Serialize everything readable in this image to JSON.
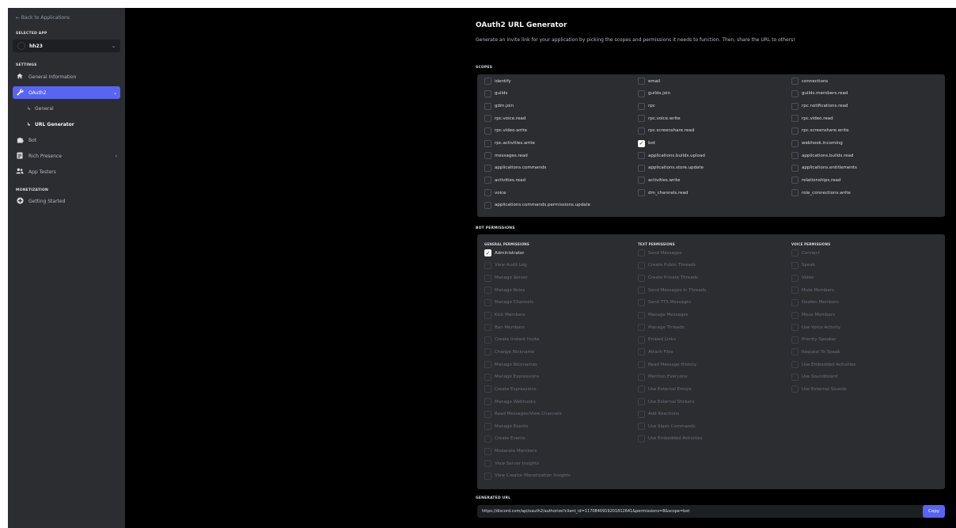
{
  "sidebar": {
    "back_link": "← Back to Applications",
    "selected_app_label": "SELECTED APP",
    "app_name": "hh23",
    "settings_label": "SETTINGS",
    "monetization_label": "MONETIZATION",
    "items": {
      "general_information": "General Information",
      "oauth2": "OAuth2",
      "general": "General",
      "url_generator": "URL Generator",
      "bot": "Bot",
      "rich_presence": "Rich Presence",
      "app_testers": "App Testers",
      "getting_started": "Getting Started"
    },
    "sub_prefix": "↳"
  },
  "page": {
    "title": "OAuth2 URL Generator",
    "description": "Generate an invite link for your application by picking the scopes and permissions it needs to function. Then, share the URL to others!",
    "scopes_label": "SCOPES",
    "bot_permissions_label": "BOT PERMISSIONS",
    "generated_url_label": "GENERATED URL"
  },
  "scopes": [
    [
      {
        "label": "identify",
        "checked": false
      },
      {
        "label": "guilds",
        "checked": false
      },
      {
        "label": "gdm.join",
        "checked": false
      },
      {
        "label": "rpc.voice.read",
        "checked": false
      },
      {
        "label": "rpc.video.write",
        "checked": false
      },
      {
        "label": "rpc.activities.write",
        "checked": false
      },
      {
        "label": "messages.read",
        "checked": false
      },
      {
        "label": "applications.commands",
        "checked": false
      },
      {
        "label": "activities.read",
        "checked": false
      },
      {
        "label": "voice",
        "checked": false
      },
      {
        "label": "applications.commands.permissions.update",
        "checked": false
      }
    ],
    [
      {
        "label": "email",
        "checked": false
      },
      {
        "label": "guilds.join",
        "checked": false
      },
      {
        "label": "rpc",
        "checked": false
      },
      {
        "label": "rpc.voice.write",
        "checked": false
      },
      {
        "label": "rpc.screenshare.read",
        "checked": false
      },
      {
        "label": "bot",
        "checked": true
      },
      {
        "label": "applications.builds.upload",
        "checked": false
      },
      {
        "label": "applications.store.update",
        "checked": false
      },
      {
        "label": "activities.write",
        "checked": false
      },
      {
        "label": "dm_channels.read",
        "checked": false
      }
    ],
    [
      {
        "label": "connections",
        "checked": false
      },
      {
        "label": "guilds.members.read",
        "checked": false
      },
      {
        "label": "rpc.notifications.read",
        "checked": false
      },
      {
        "label": "rpc.video.read",
        "checked": false
      },
      {
        "label": "rpc.screenshare.write",
        "checked": false
      },
      {
        "label": "webhook.incoming",
        "checked": false
      },
      {
        "label": "applications.builds.read",
        "checked": false
      },
      {
        "label": "applications.entitlements",
        "checked": false
      },
      {
        "label": "relationships.read",
        "checked": false
      },
      {
        "label": "role_connections.write",
        "checked": false
      }
    ]
  ],
  "permissions": [
    {
      "header": "GENERAL PERMISSIONS",
      "items": [
        {
          "label": "Administrator",
          "checked": true
        },
        {
          "label": "View Audit Log",
          "checked": false
        },
        {
          "label": "Manage Server",
          "checked": false
        },
        {
          "label": "Manage Roles",
          "checked": false
        },
        {
          "label": "Manage Channels",
          "checked": false
        },
        {
          "label": "Kick Members",
          "checked": false
        },
        {
          "label": "Ban Members",
          "checked": false
        },
        {
          "label": "Create Instant Invite",
          "checked": false
        },
        {
          "label": "Change Nickname",
          "checked": false
        },
        {
          "label": "Manage Nicknames",
          "checked": false
        },
        {
          "label": "Manage Expressions",
          "checked": false
        },
        {
          "label": "Create Expressions",
          "checked": false
        },
        {
          "label": "Manage Webhooks",
          "checked": false
        },
        {
          "label": "Read Messages/View Channels",
          "checked": false
        },
        {
          "label": "Manage Events",
          "checked": false
        },
        {
          "label": "Create Events",
          "checked": false
        },
        {
          "label": "Moderate Members",
          "checked": false
        },
        {
          "label": "View Server Insights",
          "checked": false
        },
        {
          "label": "View Creator Monetization Insights",
          "checked": false
        }
      ]
    },
    {
      "header": "TEXT PERMISSIONS",
      "items": [
        {
          "label": "Send Messages",
          "checked": false
        },
        {
          "label": "Create Public Threads",
          "checked": false
        },
        {
          "label": "Create Private Threads",
          "checked": false
        },
        {
          "label": "Send Messages in Threads",
          "checked": false
        },
        {
          "label": "Send TTS Messages",
          "checked": false
        },
        {
          "label": "Manage Messages",
          "checked": false
        },
        {
          "label": "Manage Threads",
          "checked": false
        },
        {
          "label": "Embed Links",
          "checked": false
        },
        {
          "label": "Attach Files",
          "checked": false
        },
        {
          "label": "Read Message History",
          "checked": false
        },
        {
          "label": "Mention Everyone",
          "checked": false
        },
        {
          "label": "Use External Emojis",
          "checked": false
        },
        {
          "label": "Use External Stickers",
          "checked": false
        },
        {
          "label": "Add Reactions",
          "checked": false
        },
        {
          "label": "Use Slash Commands",
          "checked": false
        },
        {
          "label": "Use Embedded Activities",
          "checked": false
        }
      ]
    },
    {
      "header": "VOICE PERMISSIONS",
      "items": [
        {
          "label": "Connect",
          "checked": false
        },
        {
          "label": "Speak",
          "checked": false
        },
        {
          "label": "Video",
          "checked": false
        },
        {
          "label": "Mute Members",
          "checked": false
        },
        {
          "label": "Deafen Members",
          "checked": false
        },
        {
          "label": "Move Members",
          "checked": false
        },
        {
          "label": "Use Voice Activity",
          "checked": false
        },
        {
          "label": "Priority Speaker",
          "checked": false
        },
        {
          "label": "Request To Speak",
          "checked": false
        },
        {
          "label": "Use Embedded Activities",
          "checked": false
        },
        {
          "label": "Use Soundboard",
          "checked": false
        },
        {
          "label": "Use External Sounds",
          "checked": false
        }
      ]
    }
  ],
  "generated_url": {
    "value": "https://discord.com/api/oauth2/authorize?client_id=1170840919201812641&permissions=8&scope=bot",
    "copy_label": "Copy"
  },
  "colors": {
    "accent": "#5865f2",
    "sidebar_bg": "#2b2d31",
    "panel_bg": "#2b2d31",
    "main_bg": "#000000"
  },
  "icons": {
    "general_information": "home-icon",
    "oauth2": "wrench-icon",
    "bot": "puzzle-icon",
    "rich_presence": "document-icon",
    "app_testers": "users-icon",
    "getting_started": "coin-icon"
  }
}
